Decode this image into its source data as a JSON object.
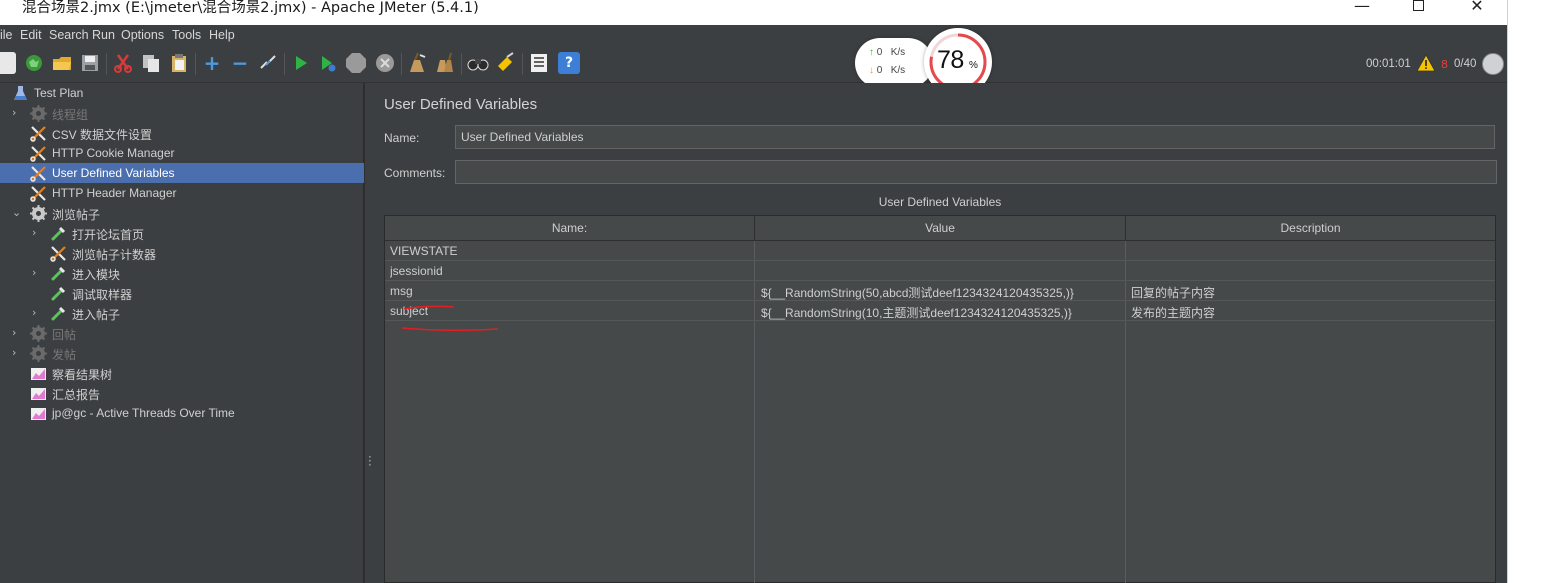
{
  "window": {
    "title": "混合场景2.jmx (E:\\jmeter\\混合场景2.jmx) - Apache JMeter (5.4.1)",
    "min_glyph": "—",
    "close_glyph": "✕"
  },
  "menu": [
    {
      "label": "ile"
    },
    {
      "label": "Edit"
    },
    {
      "label": "Search"
    },
    {
      "label": "Run"
    },
    {
      "label": "Options"
    },
    {
      "label": "Tools"
    },
    {
      "label": "Help"
    }
  ],
  "toolbar": {
    "elapsed_time": "00:01:01",
    "error_count": "8",
    "threads": "0/40",
    "buttons": [
      "new",
      "templates",
      "open",
      "save",
      "cut",
      "copy",
      "paste",
      "expand",
      "collapse",
      "toggle",
      "start",
      "start-no-pauses",
      "stop",
      "shutdown",
      "clear",
      "clear-all",
      "search",
      "reset-search",
      "function-helper",
      "help"
    ]
  },
  "speed_widget": {
    "up_value": "0",
    "up_unit": "K/s",
    "down_value": "0",
    "down_unit": "K/s",
    "cpu_percent": "78",
    "cpu_unit": "%",
    "colors": {
      "up": "#2fb344",
      "down": "#e49a2a",
      "ring": "#e5484d"
    }
  },
  "tree": [
    {
      "label": "Test Plan",
      "icon": "flask-icon",
      "toggle": "",
      "enabled": true
    },
    {
      "label": "线程组",
      "icon": "gear-icon",
      "toggle": "›",
      "enabled": false
    },
    {
      "label": "CSV 数据文件设置",
      "icon": "wrench-scissors-icon",
      "toggle": "",
      "enabled": true
    },
    {
      "label": "HTTP Cookie Manager",
      "icon": "wrench-scissors-icon",
      "toggle": "",
      "enabled": true
    },
    {
      "label": "User Defined Variables",
      "icon": "wrench-scissors-icon",
      "toggle": "",
      "enabled": true,
      "selected": true
    },
    {
      "label": "HTTP Header Manager",
      "icon": "wrench-scissors-icon",
      "toggle": "",
      "enabled": true
    },
    {
      "label": "浏览帖子",
      "icon": "gear-icon",
      "toggle": "⌄",
      "enabled": true
    },
    {
      "label": "打开论坛首页",
      "icon": "pipette-icon",
      "toggle": "›",
      "enabled": true
    },
    {
      "label": "浏览帖子计数器",
      "icon": "wrench-scissors-icon",
      "toggle": "",
      "enabled": true
    },
    {
      "label": "进入模块",
      "icon": "pipette-icon",
      "toggle": "›",
      "enabled": true
    },
    {
      "label": "调试取样器",
      "icon": "pipette-icon",
      "toggle": "",
      "enabled": true
    },
    {
      "label": "进入帖子",
      "icon": "pipette-icon",
      "toggle": "›",
      "enabled": true
    },
    {
      "label": "回帖",
      "icon": "gear-icon",
      "toggle": "›",
      "enabled": false
    },
    {
      "label": "发帖",
      "icon": "gear-icon",
      "toggle": "›",
      "enabled": false
    },
    {
      "label": "察看结果树",
      "icon": "graph-icon",
      "toggle": "",
      "enabled": true
    },
    {
      "label": "汇总报告",
      "icon": "graph-icon",
      "toggle": "",
      "enabled": true
    },
    {
      "label": "jp@gc - Active Threads Over Time",
      "icon": "graph-icon",
      "toggle": "",
      "enabled": true
    }
  ],
  "panel": {
    "title": "User Defined Variables",
    "name_label": "Name:",
    "name_value": "User Defined Variables",
    "comments_label": "Comments:",
    "comments_value": "",
    "table_caption": "User Defined Variables",
    "columns": [
      "Name:",
      "Value",
      "Description"
    ],
    "rows": [
      {
        "name": "VIEWSTATE",
        "value": "",
        "description": ""
      },
      {
        "name": "jsessionid",
        "value": "",
        "description": ""
      },
      {
        "name": "msg",
        "value": "${__RandomString(50,abcd测试deef1234324120435325,)}",
        "description": "回复的帖子内容"
      },
      {
        "name": "subject",
        "value": "${__RandomString(10,主题测试deef1234324120435325,)}",
        "description": "发布的主题内容"
      }
    ]
  }
}
